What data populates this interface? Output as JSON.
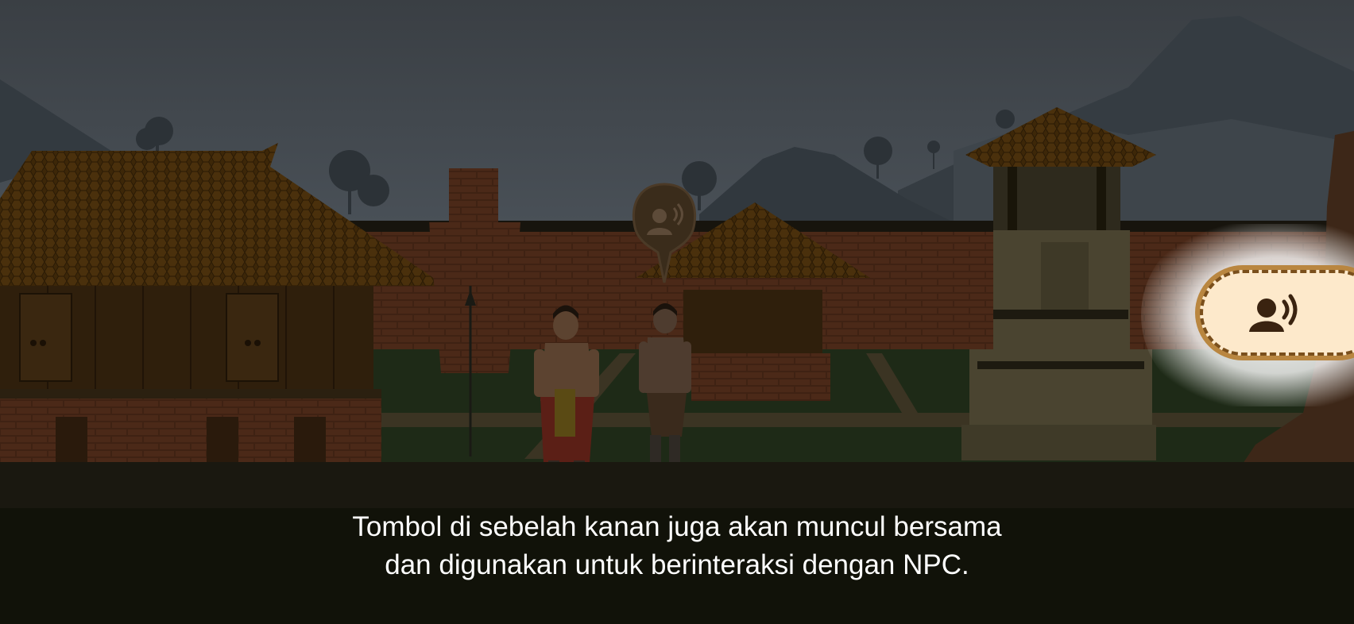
{
  "caption": {
    "line1": "Tombol di sebelah kanan juga akan muncul bersama",
    "line2": "dan digunakan untuk berinteraksi dengan NPC."
  },
  "interact_button": {
    "icon": "talk-icon"
  },
  "npc_prompt": {
    "icon": "talk-icon"
  },
  "colors": {
    "overlay_dark": "#111209",
    "button_fill": "#fde9cb",
    "button_border": "#b98640",
    "icon_color": "#3a2310"
  }
}
